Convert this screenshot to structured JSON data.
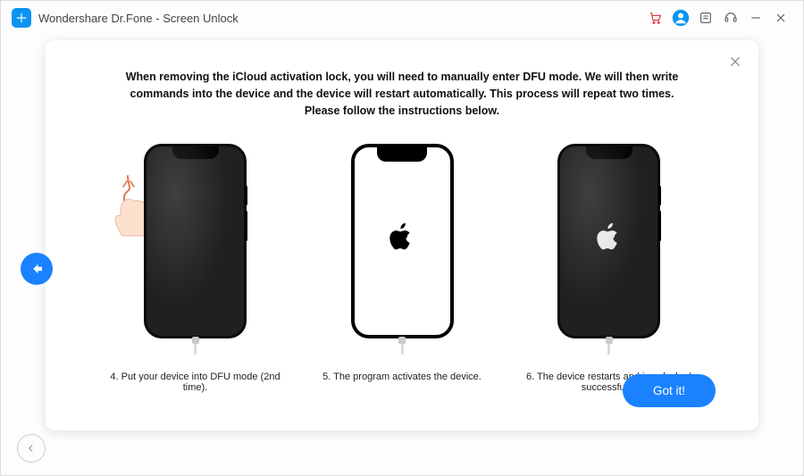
{
  "app": {
    "title": "Wondershare Dr.Fone - Screen Unlock"
  },
  "titlebar_icons": {
    "cart": "cart-icon",
    "account": "account-icon",
    "feedback": "feedback-icon",
    "support": "support-icon",
    "minimize": "minimize-icon",
    "close": "close-icon"
  },
  "modal": {
    "intro": "When removing the iCloud activation lock, you will need to manually enter DFU mode. We will then write commands into the device and the device will restart automatically. This process will repeat two times. Please follow the instructions below.",
    "steps": [
      {
        "caption": "4. Put your device into DFU mode (2nd time)."
      },
      {
        "caption": "5. The program activates the device."
      },
      {
        "caption": "6. The device restarts and is unlocked successfully."
      }
    ],
    "button_label": "Got it!"
  },
  "colors": {
    "accent": "#1a82ff",
    "brand": "#0c94f0"
  }
}
